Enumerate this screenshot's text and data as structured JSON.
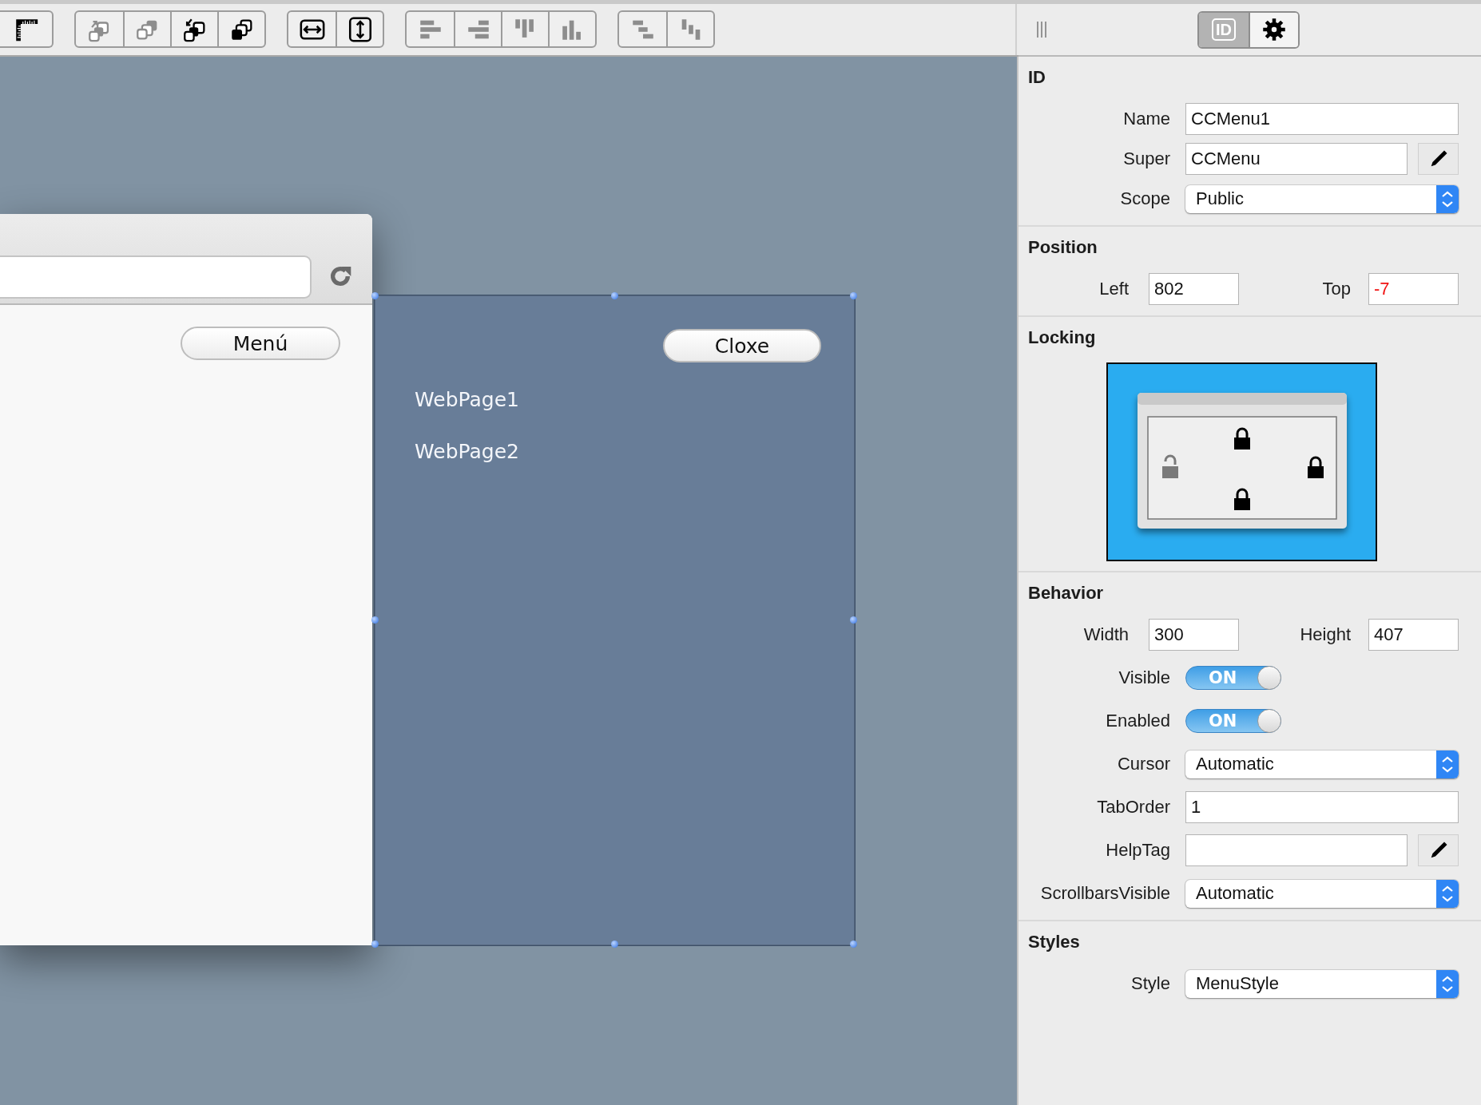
{
  "toolbar": {
    "groups": [
      [
        {
          "disabled": false
        }
      ],
      [
        {
          "disabled": true
        },
        {
          "disabled": true
        },
        {
          "disabled": false
        },
        {
          "disabled": false
        }
      ],
      [
        {
          "disabled": false
        },
        {
          "disabled": false
        }
      ],
      [
        {
          "disabled": true
        },
        {
          "disabled": true
        },
        {
          "disabled": true
        },
        {
          "disabled": true
        }
      ],
      [
        {
          "disabled": true
        },
        {
          "disabled": true
        }
      ]
    ]
  },
  "canvas": {
    "browser_window": {
      "button": "Menú"
    },
    "menu_panel": {
      "selected": true,
      "close_button": "Cloxe",
      "items": [
        "WebPage1",
        "WebPage2"
      ]
    }
  },
  "inspector": {
    "tabs": [
      {
        "kind": "label",
        "label": "ID",
        "selected": true
      },
      {
        "kind": "gear",
        "selected": false
      }
    ],
    "sections": [
      {
        "title": "ID",
        "rows": [
          {
            "kind": "text",
            "label": "Name",
            "value": "CCMenu1"
          },
          {
            "kind": "text_edit",
            "label": "Super",
            "value": "CCMenu"
          },
          {
            "kind": "popup",
            "label": "Scope",
            "value": "Public"
          }
        ]
      },
      {
        "title": "Position",
        "rows": [
          {
            "kind": "pair",
            "fields": [
              {
                "label": "Left",
                "value": "802",
                "error": false
              },
              {
                "label": "Top",
                "value": "-7",
                "error": true
              }
            ]
          }
        ]
      },
      {
        "title": "Locking",
        "rows": [
          {
            "kind": "locking",
            "locks": {
              "top": true,
              "left": false,
              "right": true,
              "bottom": true
            }
          }
        ]
      },
      {
        "title": "Behavior",
        "rows": [
          {
            "kind": "pair",
            "fields": [
              {
                "label": "Width",
                "value": "300",
                "error": false
              },
              {
                "label": "Height",
                "value": "407",
                "error": false
              }
            ]
          },
          {
            "kind": "toggle",
            "label": "Visible",
            "on": true,
            "state_label": "ON"
          },
          {
            "kind": "toggle",
            "label": "Enabled",
            "on": true,
            "state_label": "ON"
          },
          {
            "kind": "popup",
            "label": "Cursor",
            "value": "Automatic"
          },
          {
            "kind": "text",
            "label": "TabOrder",
            "value": "1"
          },
          {
            "kind": "text_edit",
            "label": "HelpTag"
          },
          {
            "kind": "popup",
            "label": "ScrollbarsVisible",
            "value": "Automatic"
          }
        ]
      },
      {
        "title": "Styles",
        "rows": [
          {
            "kind": "popup",
            "label": "Style",
            "value": "MenuStyle"
          }
        ]
      }
    ]
  }
}
